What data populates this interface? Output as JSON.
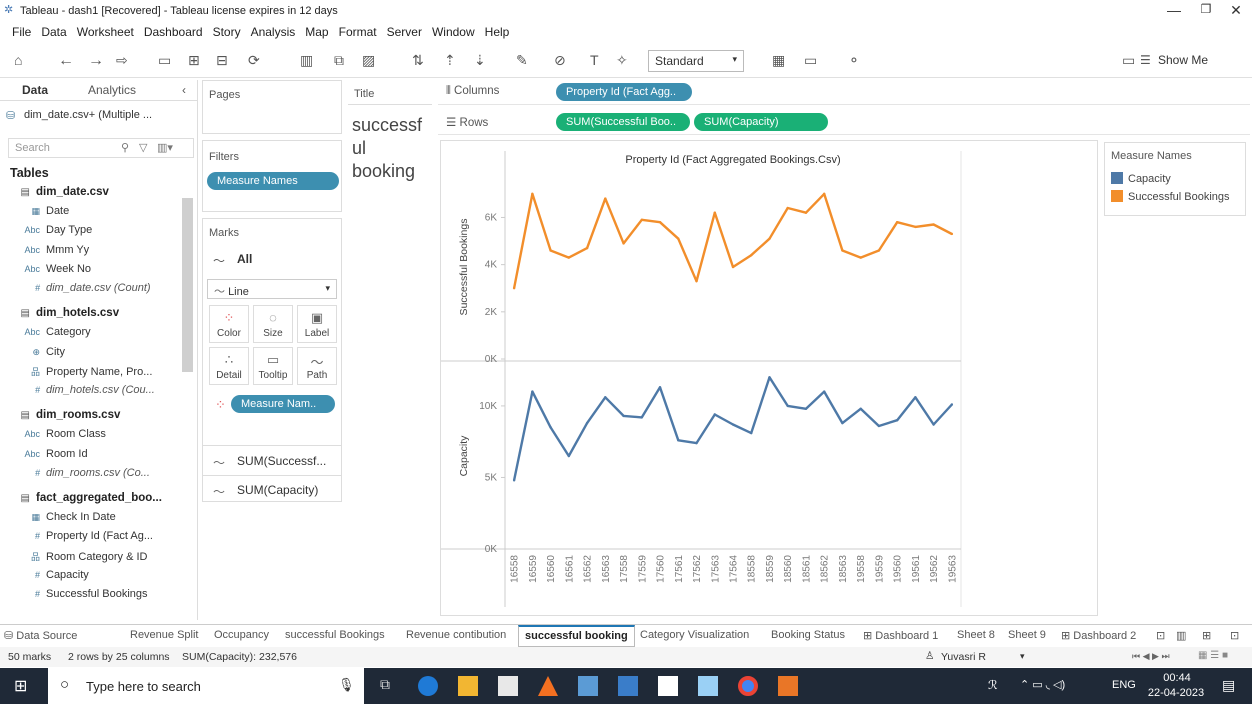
{
  "window": {
    "title": "Tableau - dash1 [Recovered] - Tableau license expires in 12 days"
  },
  "menu": [
    "File",
    "Data",
    "Worksheet",
    "Dashboard",
    "Story",
    "Analysis",
    "Map",
    "Format",
    "Server",
    "Window",
    "Help"
  ],
  "toolbar": {
    "fit": "Standard",
    "show_me": "Show Me"
  },
  "left": {
    "tab_data": "Data",
    "tab_analytics": "Analytics",
    "datasource": "dim_date.csv+ (Multiple ...",
    "search_placeholder": "Search",
    "tables_title": "Tables",
    "items": [
      {
        "type": "grp",
        "ic": "▤",
        "label": "dim_date.csv"
      },
      {
        "type": "fld",
        "ic": "▦",
        "label": "Date"
      },
      {
        "type": "fld",
        "ic": "Abc",
        "label": "Day Type"
      },
      {
        "type": "fld",
        "ic": "Abc",
        "label": "Mmm Yy"
      },
      {
        "type": "fld",
        "ic": "Abc",
        "label": "Week No"
      },
      {
        "type": "it",
        "ic": "#",
        "label": "dim_date.csv (Count)"
      },
      {
        "type": "grp",
        "ic": "▤",
        "label": "dim_hotels.csv"
      },
      {
        "type": "fld",
        "ic": "Abc",
        "label": "Category"
      },
      {
        "type": "fld",
        "ic": "⊕",
        "label": "City"
      },
      {
        "type": "fld",
        "ic": "品",
        "label": "Property Name, Pro..."
      },
      {
        "type": "it",
        "ic": "#",
        "label": "dim_hotels.csv (Cou..."
      },
      {
        "type": "grp",
        "ic": "▤",
        "label": "dim_rooms.csv"
      },
      {
        "type": "fld",
        "ic": "Abc",
        "label": "Room Class"
      },
      {
        "type": "fld",
        "ic": "Abc",
        "label": "Room Id"
      },
      {
        "type": "it",
        "ic": "#",
        "label": "dim_rooms.csv (Co..."
      },
      {
        "type": "grp",
        "ic": "▤",
        "label": "fact_aggregated_boo..."
      },
      {
        "type": "fld",
        "ic": "▦",
        "label": "Check In Date"
      },
      {
        "type": "fld",
        "ic": "#",
        "label": "Property Id (Fact Ag..."
      },
      {
        "type": "fld",
        "ic": "品",
        "label": "Room Category & ID"
      },
      {
        "type": "fld",
        "ic": "#",
        "label": "Capacity"
      },
      {
        "type": "fld",
        "ic": "#",
        "label": "Successful Bookings"
      }
    ]
  },
  "shelves": {
    "pages": "Pages",
    "filters": "Filters",
    "filter_pill": "Measure Names",
    "marks": "Marks",
    "marks_all": "All",
    "mark_type": "Line",
    "mark_buttons": [
      "Color",
      "Size",
      "Label",
      "Detail",
      "Tooltip",
      "Path"
    ],
    "marks_pill": "Measure Nam..",
    "marks_sub1": "SUM(Successf...",
    "marks_sub2": "SUM(Capacity)",
    "columns": "Columns",
    "rows": "Rows",
    "col_pill": "Property Id (Fact Agg..",
    "row_pill1": "SUM(Successful Boo..",
    "row_pill2": "SUM(Capacity)"
  },
  "title_card": {
    "label": "Title",
    "text": [
      "successf",
      "ul",
      "booking"
    ]
  },
  "chart_data": {
    "type": "line",
    "title": "Property Id (Fact Aggregated Bookings.Csv)",
    "categories": [
      "16558",
      "16559",
      "16560",
      "16561",
      "16562",
      "16563",
      "17558",
      "17559",
      "17560",
      "17561",
      "17562",
      "17563",
      "17564",
      "18558",
      "18559",
      "18560",
      "18561",
      "18562",
      "18563",
      "19558",
      "19559",
      "19560",
      "19561",
      "19562",
      "19563"
    ],
    "series": [
      {
        "name": "Successful Bookings",
        "color": "#f28e2b",
        "ylabel": "Successful Bookings",
        "ylim": [
          0,
          7800
        ],
        "ticks": [
          0,
          2000,
          4000,
          6000
        ],
        "tick_labels": [
          "0K",
          "2K",
          "4K",
          "6K"
        ],
        "values": [
          3000,
          7000,
          4600,
          4300,
          4700,
          6800,
          4900,
          5900,
          5800,
          5100,
          3300,
          6200,
          3900,
          4400,
          5100,
          6400,
          6200,
          7000,
          4600,
          4300,
          4600,
          5800,
          5600,
          5700,
          5300
        ]
      },
      {
        "name": "Capacity",
        "color": "#4e79a7",
        "ylabel": "Capacity",
        "ylim": [
          0,
          13000
        ],
        "ticks": [
          0,
          5000,
          10000
        ],
        "tick_labels": [
          "0K",
          "5K",
          "10K"
        ],
        "values": [
          4800,
          11000,
          8500,
          6500,
          8800,
          10600,
          9300,
          9200,
          11300,
          7600,
          7400,
          9400,
          8700,
          8100,
          12000,
          10000,
          9800,
          11000,
          8800,
          9800,
          8600,
          9000,
          10600,
          8700,
          10100
        ]
      }
    ]
  },
  "legend": {
    "title": "Measure Names",
    "items": [
      {
        "label": "Capacity",
        "color": "#4e79a7"
      },
      {
        "label": "Successful Bookings",
        "color": "#f28e2b"
      }
    ]
  },
  "sheet_tabs": [
    "Data Source",
    "Revenue Split",
    "Occupancy",
    "successful Bookings",
    "Revenue contibution",
    "successful booking",
    "Category Visualization",
    "Booking Status",
    "Dashboard 1",
    "Sheet 8",
    "Sheet 9",
    "Dashboard 2"
  ],
  "status": {
    "marks": "50 marks",
    "dims": "2 rows by 25 columns",
    "sum": "SUM(Capacity): 232,576",
    "user": "Yuvasri R"
  },
  "taskbar": {
    "search": "Type here to search",
    "lang": "ENG",
    "time": "00:44",
    "date": "22-04-2023"
  }
}
